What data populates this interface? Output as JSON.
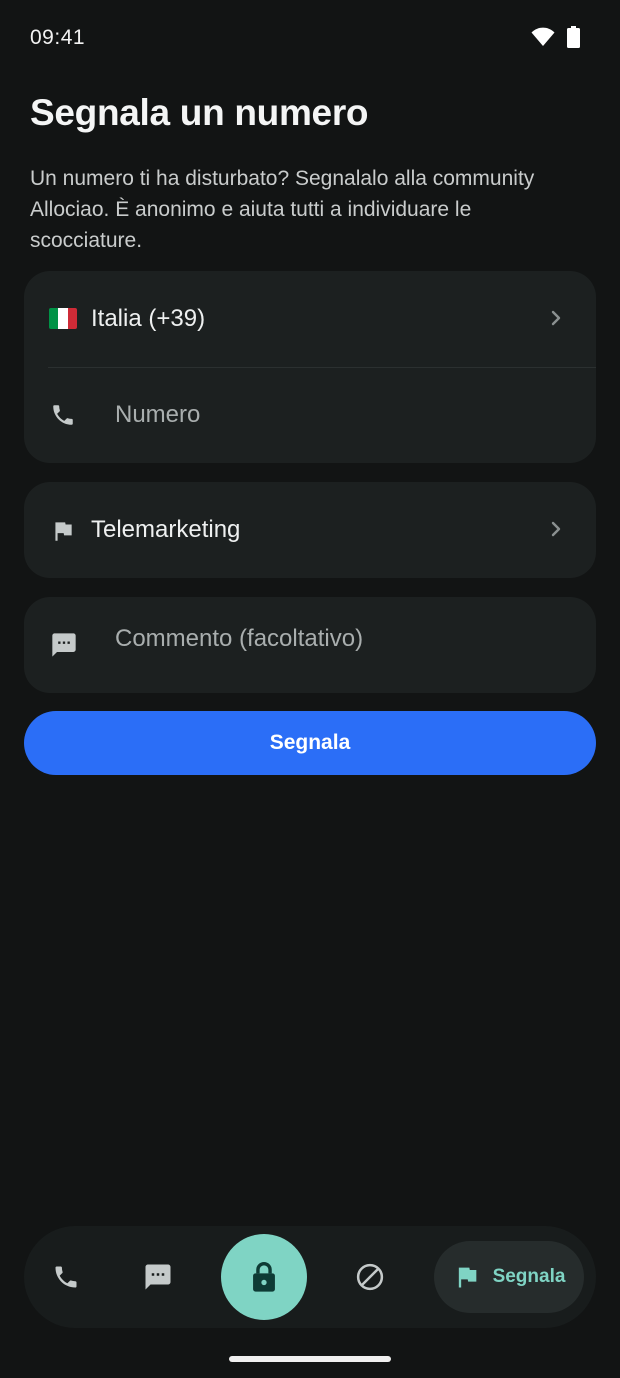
{
  "status_bar": {
    "time": "09:41",
    "icons": [
      "wifi-icon",
      "battery-icon"
    ]
  },
  "header": {
    "title": "Segnala un numero",
    "subtitle": "Un numero ti ha disturbato? Segnalalo alla community Allociao. È anonimo e aiuta tutti a individuare le scocciature."
  },
  "form": {
    "country": {
      "label": "Italia (+39)",
      "flag_icon": "italy-flag-icon",
      "flag_colors": [
        "#009246",
        "#ffffff",
        "#ce2b37"
      ]
    },
    "number": {
      "placeholder": "Numero",
      "icon": "phone-icon"
    },
    "category": {
      "label": "Telemarketing",
      "icon": "flag-icon"
    },
    "comment": {
      "placeholder": "Commento (facoltativo)",
      "icon": "comment-icon"
    },
    "submit_label": "Segnala"
  },
  "bottom_nav": {
    "items": [
      {
        "name": "calls",
        "icon": "phone-icon"
      },
      {
        "name": "messages",
        "icon": "message-icon"
      },
      {
        "name": "lock",
        "icon": "lock-icon"
      },
      {
        "name": "blocked",
        "icon": "block-icon"
      },
      {
        "name": "report",
        "icon": "flag-icon",
        "label": "Segnala",
        "selected": true
      }
    ]
  },
  "colors": {
    "background": "#121414",
    "card": "#1c2020",
    "accent": "#2b6ef7",
    "teal": "#7fd4c4"
  }
}
